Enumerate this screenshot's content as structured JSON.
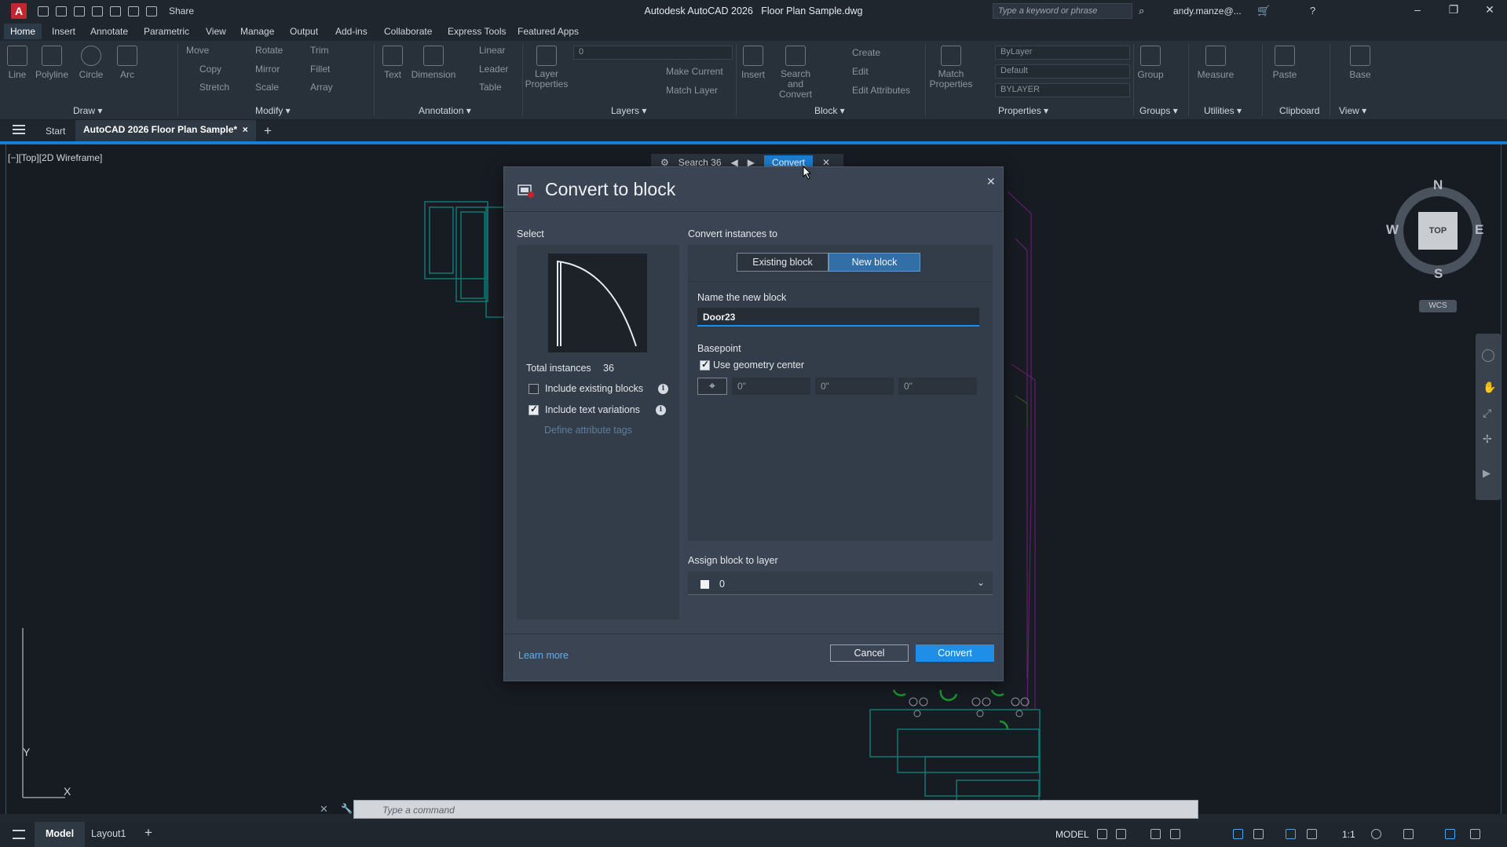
{
  "titlebar": {
    "app_name": "Autodesk AutoCAD 2026",
    "file_name": "Floor Plan Sample.dwg",
    "share_label": "Share",
    "search_placeholder": "Type a keyword or phrase",
    "user": "andy.manze@..."
  },
  "menu_tabs": [
    "Home",
    "Insert",
    "Annotate",
    "Parametric",
    "View",
    "Manage",
    "Output",
    "Add-ins",
    "Collaborate",
    "Express Tools",
    "Featured Apps"
  ],
  "ribbon": {
    "draw": {
      "title": "Draw",
      "tools": [
        "Line",
        "Polyline",
        "Circle",
        "Arc"
      ]
    },
    "modify": {
      "title": "Modify",
      "tools": [
        "Move",
        "Rotate",
        "Trim",
        "Copy",
        "Mirror",
        "Fillet",
        "Stretch",
        "Scale",
        "Array"
      ]
    },
    "annotation": {
      "title": "Annotation",
      "tools": [
        "Text",
        "Dimension",
        "Linear",
        "Leader",
        "Table"
      ]
    },
    "layers": {
      "title": "Layers",
      "layer_combo": "0",
      "tools": [
        "Layer Properties",
        "Make Current",
        "Match Layer"
      ]
    },
    "block": {
      "title": "Block",
      "tools": [
        "Insert",
        "Search and Convert",
        "Create",
        "Edit",
        "Edit Attributes"
      ]
    },
    "properties": {
      "title": "Properties",
      "tools": [
        "Match Properties"
      ],
      "combo_color": "ByLayer",
      "combo_linetype": "Default",
      "combo_lineweight": "BYLAYER"
    },
    "groups": {
      "title": "Groups",
      "tools": [
        "Group"
      ]
    },
    "utilities": {
      "title": "Utilities",
      "tools": [
        "Measure"
      ]
    },
    "clipboard": {
      "title": "Clipboard",
      "tools": [
        "Paste"
      ]
    },
    "view": {
      "title": "View",
      "tools": [
        "Base"
      ]
    }
  },
  "file_tabs": {
    "start": "Start",
    "active": "AutoCAD 2026  Floor Plan Sample*",
    "close": "×",
    "add": "+"
  },
  "viewport_label": "[−][Top][2D Wireframe]",
  "search_toolbar": {
    "label": "Search",
    "count": "36",
    "convert": "Convert"
  },
  "dialog": {
    "title": "Convert to block",
    "select_label": "Select",
    "total_instances_label": "Total instances",
    "total_instances_value": "36",
    "include_existing_blocks": {
      "label": "Include existing blocks",
      "checked": false
    },
    "include_text_variations": {
      "label": "Include text variations",
      "checked": true
    },
    "define_attribute_tags": "Define attribute tags",
    "convert_instances_to_label": "Convert instances to",
    "options": [
      "Existing block",
      "New block"
    ],
    "selected_option": "New block",
    "name_label": "Name the new block",
    "name_value": "Door23",
    "basepoint_label": "Basepoint",
    "use_geometry_center": {
      "label": "Use geometry center",
      "checked": true
    },
    "basepoint_x": "0\"",
    "basepoint_y": "0\"",
    "basepoint_z": "0\"",
    "assign_layer_label": "Assign block to layer",
    "layer_value": "0",
    "learn_more": "Learn more",
    "cancel": "Cancel",
    "convert": "Convert"
  },
  "viewcube": {
    "north": "N",
    "south": "S",
    "east": "E",
    "west": "W",
    "face": "TOP",
    "wcs": "WCS"
  },
  "ucs": {
    "x": "X",
    "y": "Y"
  },
  "command_line": {
    "placeholder": "Type a command"
  },
  "status_bar": {
    "model_tab": "Model",
    "layout_tab": "Layout1",
    "model_label": "MODEL",
    "scale": "1:1"
  }
}
